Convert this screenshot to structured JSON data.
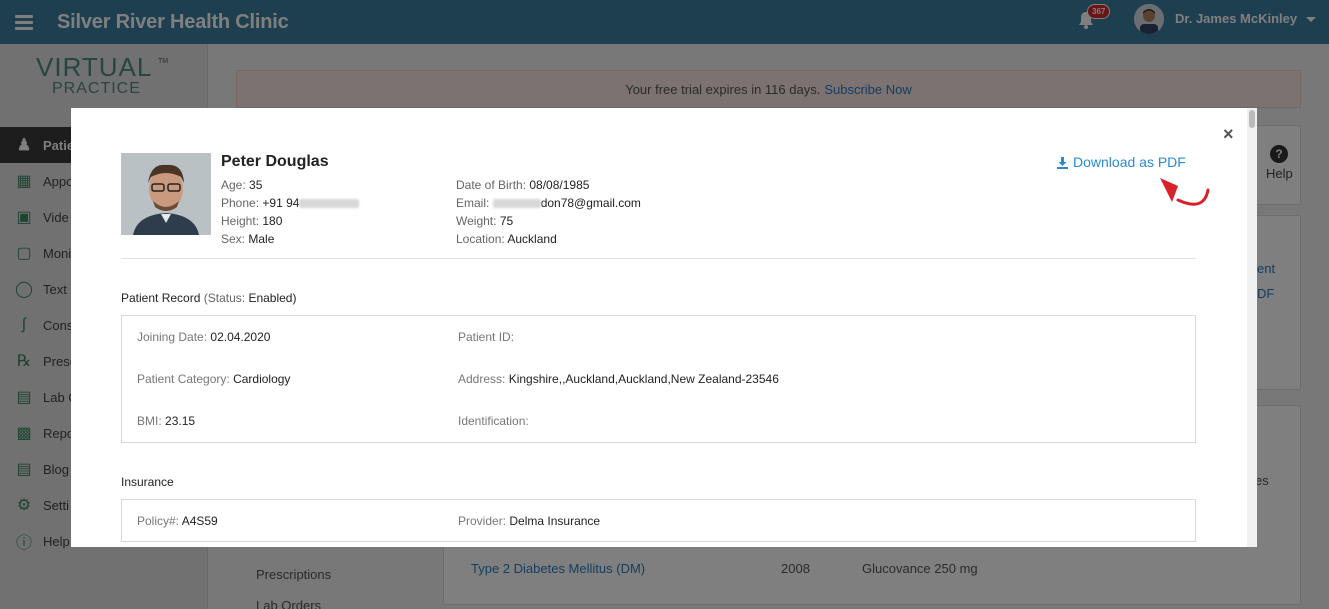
{
  "header": {
    "title": "Silver River Health Clinic",
    "notifications_count": "367",
    "user_name": "Dr. James McKinley"
  },
  "sidebar": {
    "logo_top": "VIRTUAL",
    "logo_bottom": "PRACTICE",
    "items": [
      {
        "label": "Patie",
        "icon": "patients-icon"
      },
      {
        "label": "Appo",
        "icon": "calendar-icon"
      },
      {
        "label": "Vide",
        "icon": "video-icon"
      },
      {
        "label": "Moni",
        "icon": "monitor-icon"
      },
      {
        "label": "Text C",
        "icon": "chat-icon"
      },
      {
        "label": "Cons",
        "icon": "stethoscope-icon"
      },
      {
        "label": "Presc",
        "icon": "prescription-icon"
      },
      {
        "label": "Lab C",
        "icon": "lab-icon"
      },
      {
        "label": "Repo",
        "icon": "reports-icon"
      },
      {
        "label": "Blog",
        "icon": "blog-icon"
      },
      {
        "label": "Setti",
        "icon": "settings-icon"
      },
      {
        "label": "Help",
        "icon": "help-icon"
      }
    ]
  },
  "trial": {
    "text": "Your free trial expires in 116 days.",
    "link": "Subscribe Now"
  },
  "background": {
    "help_label": "Help",
    "link_partial_1": "ent",
    "link_partial_2": "DF",
    "column_partial": "es",
    "condition_link": "Type 2 Diabetes Mellitus (DM)",
    "condition_year": "2008",
    "condition_med": "Glucovance 250 mg",
    "menu_prescriptions": "Prescriptions",
    "menu_lab_orders": "Lab Orders"
  },
  "modal": {
    "close": "×",
    "download_label": "Download as PDF",
    "patient": {
      "name": "Peter Douglas",
      "age_label": "Age:",
      "age": "35",
      "phone_label": "Phone:",
      "phone_prefix": "+91 94",
      "height_label": "Height:",
      "height": "180",
      "sex_label": "Sex:",
      "sex": "Male",
      "dob_label": "Date of Birth:",
      "dob": "08/08/1985",
      "email_label": "Email:",
      "email_suffix": "don78@gmail.com",
      "weight_label": "Weight:",
      "weight": "75",
      "location_label": "Location:",
      "location": "Auckland"
    },
    "record": {
      "title": "Patient Record",
      "status_label": "(Status:",
      "status_value": "Enabled)",
      "joining_label": "Joining Date:",
      "joining": "02.04.2020",
      "patient_id_label": "Patient ID:",
      "category_label": "Patient Category:",
      "category": "Cardiology",
      "address_label": "Address:",
      "address": "Kingshire,,Auckland,Auckland,New Zealand-23546",
      "bmi_label": "BMI:",
      "bmi": "23.15",
      "identification_label": "Identification:"
    },
    "insurance": {
      "title": "Insurance",
      "policy_label": "Policy#:",
      "policy": "A4S59",
      "provider_label": "Provider:",
      "provider": "Delma Insurance"
    }
  }
}
